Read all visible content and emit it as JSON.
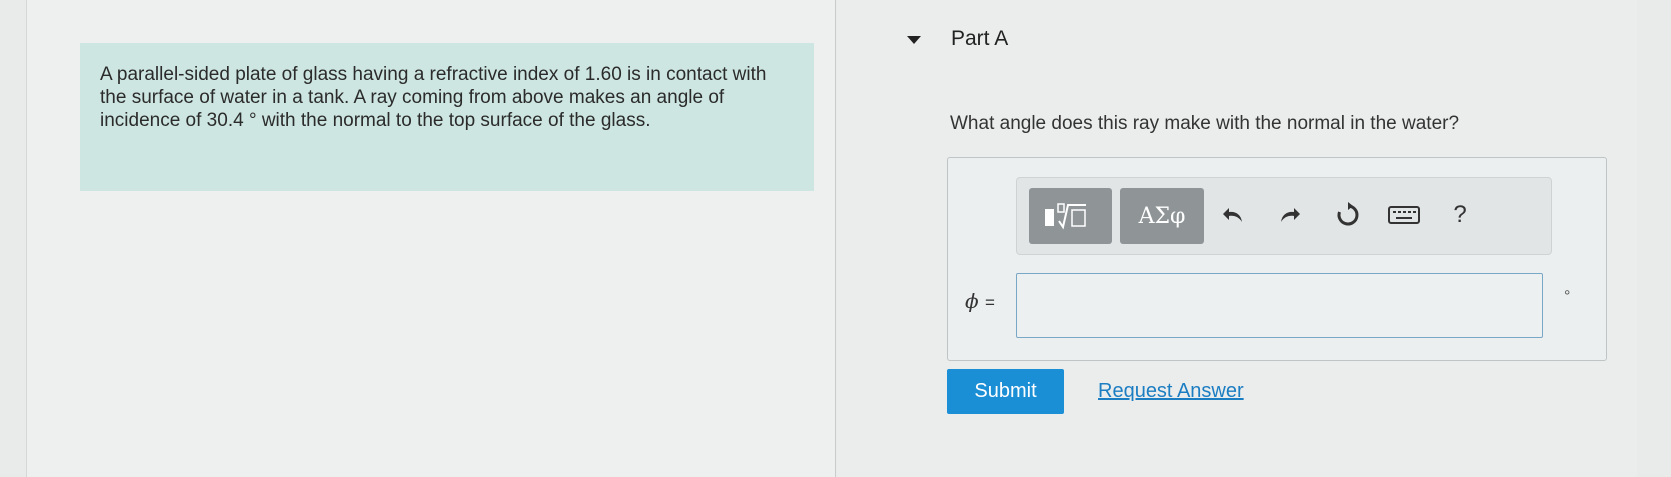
{
  "problem": {
    "text": "A parallel-sided plate of glass having a refractive index of 1.60 is in contact with the surface of water in a tank. A ray coming from above makes an angle of incidence of 30.4 ° with the normal to the top surface of the glass."
  },
  "part": {
    "title": "Part A",
    "question": "What angle does this ray make with the normal in the water?"
  },
  "toolbar": {
    "greek_label": "ΑΣφ",
    "help_label": "?"
  },
  "answer": {
    "variable_label": "ϕ",
    "equals": "=",
    "value": "",
    "unit": "°"
  },
  "actions": {
    "submit_label": "Submit",
    "request_label": "Request Answer"
  },
  "colors": {
    "problem_bg": "#cde6e1",
    "submit_bg": "#1a8fd6",
    "link": "#1b7dc2",
    "toolbar_button": "#8f9597"
  }
}
